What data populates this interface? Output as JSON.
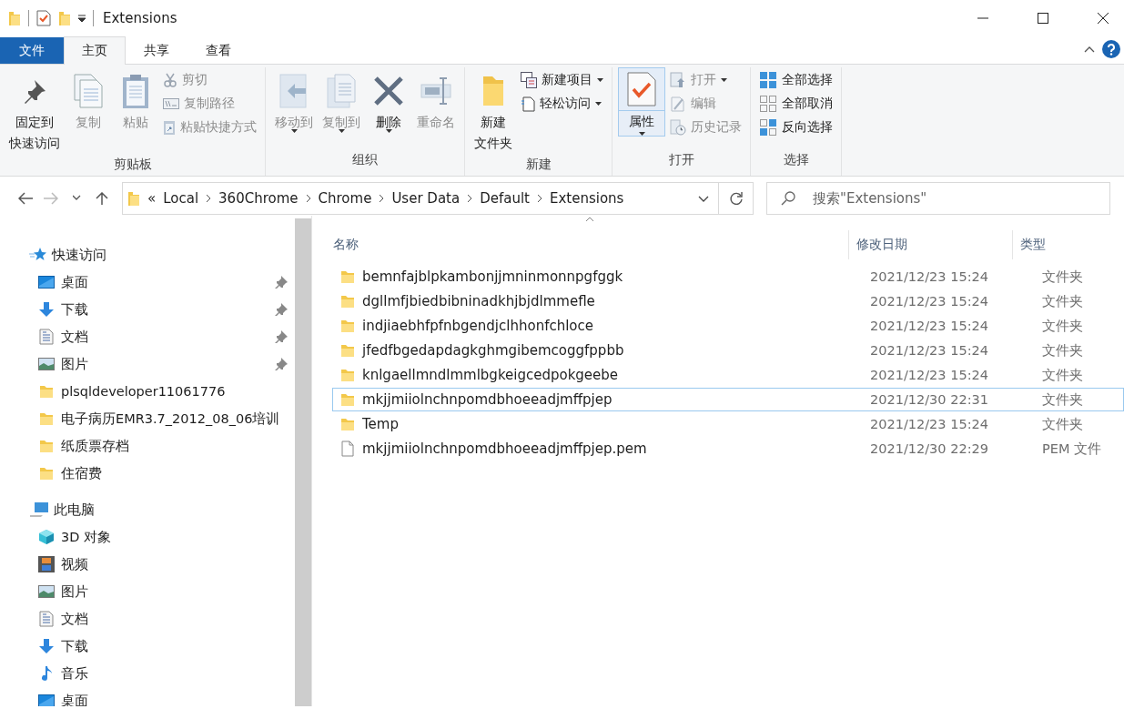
{
  "window": {
    "title": "Extensions"
  },
  "tabs": [
    {
      "label": "文件",
      "kind": "file",
      "selected": false
    },
    {
      "label": "主页",
      "kind": "tab",
      "selected": true
    },
    {
      "label": "共享",
      "kind": "tab",
      "selected": false
    },
    {
      "label": "查看",
      "kind": "tab",
      "selected": false
    }
  ],
  "ribbon": {
    "groups": [
      {
        "label": "剪贴板",
        "items": [
          {
            "kind": "large",
            "label": [
              "固定到",
              "快速访问"
            ],
            "disabled": false
          },
          {
            "kind": "large",
            "label": [
              "复制"
            ],
            "disabled": true
          },
          {
            "kind": "large",
            "label": [
              "粘贴"
            ],
            "disabled": true
          },
          {
            "kind": "stack",
            "items": [
              {
                "label": "剪切",
                "disabled": true
              },
              {
                "label": "复制路径",
                "disabled": true
              },
              {
                "label": "粘贴快捷方式",
                "disabled": true
              }
            ]
          }
        ]
      },
      {
        "label": "组织",
        "items": [
          {
            "kind": "large",
            "label": [
              "移动到"
            ],
            "disabled": true,
            "dropdown": true
          },
          {
            "kind": "large",
            "label": [
              "复制到"
            ],
            "disabled": true,
            "dropdown": true
          },
          {
            "kind": "large",
            "label": [
              "删除"
            ],
            "disabled": false,
            "dropdown": true
          },
          {
            "kind": "large",
            "label": [
              "重命名"
            ],
            "disabled": true
          }
        ]
      },
      {
        "label": "新建",
        "items": [
          {
            "kind": "large",
            "label": [
              "新建",
              "文件夹"
            ],
            "disabled": false
          },
          {
            "kind": "stack",
            "items": [
              {
                "label": "新建项目",
                "disabled": false,
                "dropdown": true
              },
              {
                "label": "轻松访问",
                "disabled": false,
                "dropdown": true
              }
            ]
          }
        ]
      },
      {
        "label": "打开",
        "items": [
          {
            "kind": "large",
            "label": [
              "属性"
            ],
            "disabled": false,
            "dropdown": true,
            "split": true
          },
          {
            "kind": "stack",
            "items": [
              {
                "label": "打开",
                "disabled": true,
                "dropdown": true
              },
              {
                "label": "编辑",
                "disabled": true
              },
              {
                "label": "历史记录",
                "disabled": true
              }
            ]
          }
        ]
      },
      {
        "label": "选择",
        "items": [
          {
            "kind": "stack",
            "items": [
              {
                "label": "全部选择",
                "disabled": false
              },
              {
                "label": "全部取消",
                "disabled": false
              },
              {
                "label": "反向选择",
                "disabled": false
              }
            ]
          }
        ]
      }
    ]
  },
  "address": {
    "crumbs": [
      "Local",
      "360Chrome",
      "Chrome",
      "User Data",
      "Default",
      "Extensions"
    ],
    "overflow": "«"
  },
  "search": {
    "placeholder": "搜索\"Extensions\""
  },
  "nav": [
    {
      "label": "快速访问",
      "kind": "star",
      "children": [
        {
          "label": "桌面",
          "kind": "desktop",
          "pinned": true
        },
        {
          "label": "下载",
          "kind": "download",
          "pinned": true
        },
        {
          "label": "文档",
          "kind": "doc",
          "pinned": true
        },
        {
          "label": "图片",
          "kind": "picture",
          "pinned": true
        },
        {
          "label": "plsqldeveloper11061776",
          "kind": "folder",
          "pinned": false
        },
        {
          "label": "电子病历EMR3.7_2012_08_06培训",
          "kind": "folder",
          "pinned": false
        },
        {
          "label": "纸质票存档",
          "kind": "folder",
          "pinned": false
        },
        {
          "label": "住宿费",
          "kind": "folder",
          "pinned": false
        }
      ]
    },
    {
      "label": "此电脑",
      "kind": "pc",
      "children": [
        {
          "label": "3D 对象",
          "kind": "cube",
          "pinned": false
        },
        {
          "label": "视频",
          "kind": "video",
          "pinned": false
        },
        {
          "label": "图片",
          "kind": "picture",
          "pinned": false
        },
        {
          "label": "文档",
          "kind": "doc",
          "pinned": false
        },
        {
          "label": "下载",
          "kind": "download",
          "pinned": false
        },
        {
          "label": "音乐",
          "kind": "music",
          "pinned": false
        },
        {
          "label": "桌面",
          "kind": "desktop",
          "pinned": false
        }
      ]
    }
  ],
  "table": {
    "columns": [
      "名称",
      "修改日期",
      "类型"
    ],
    "rows": [
      {
        "kind": "folder",
        "name": "bemnfajblpkambonjjmninmonnpgfggk",
        "date": "2021/12/23 15:24",
        "type": "文件夹",
        "focused": false
      },
      {
        "kind": "folder",
        "name": "dgllmfjbiedbibninadkhjbjdlmmefle",
        "date": "2021/12/23 15:24",
        "type": "文件夹",
        "focused": false
      },
      {
        "kind": "folder",
        "name": "indjiaebhfpfnbgendjclhhonfchloce",
        "date": "2021/12/23 15:24",
        "type": "文件夹",
        "focused": false
      },
      {
        "kind": "folder",
        "name": "jfedfbgedapdagkghmgibemcoggfppbb",
        "date": "2021/12/23 15:24",
        "type": "文件夹",
        "focused": false
      },
      {
        "kind": "folder",
        "name": "knlgaellmndlmmlbgkeigcedpokgeebe",
        "date": "2021/12/23 15:24",
        "type": "文件夹",
        "focused": false
      },
      {
        "kind": "folder",
        "name": "mkjjmiiolnchnpomdbhoeeadjmffpjep",
        "date": "2021/12/30 22:31",
        "type": "文件夹",
        "focused": true
      },
      {
        "kind": "folder",
        "name": "Temp",
        "date": "2021/12/23 15:24",
        "type": "文件夹",
        "focused": false
      },
      {
        "kind": "file",
        "name": "mkjjmiiolnchnpomdbhoeeadjmffpjep.pem",
        "date": "2021/12/30 22:29",
        "type": "PEM 文件",
        "focused": false
      }
    ]
  }
}
